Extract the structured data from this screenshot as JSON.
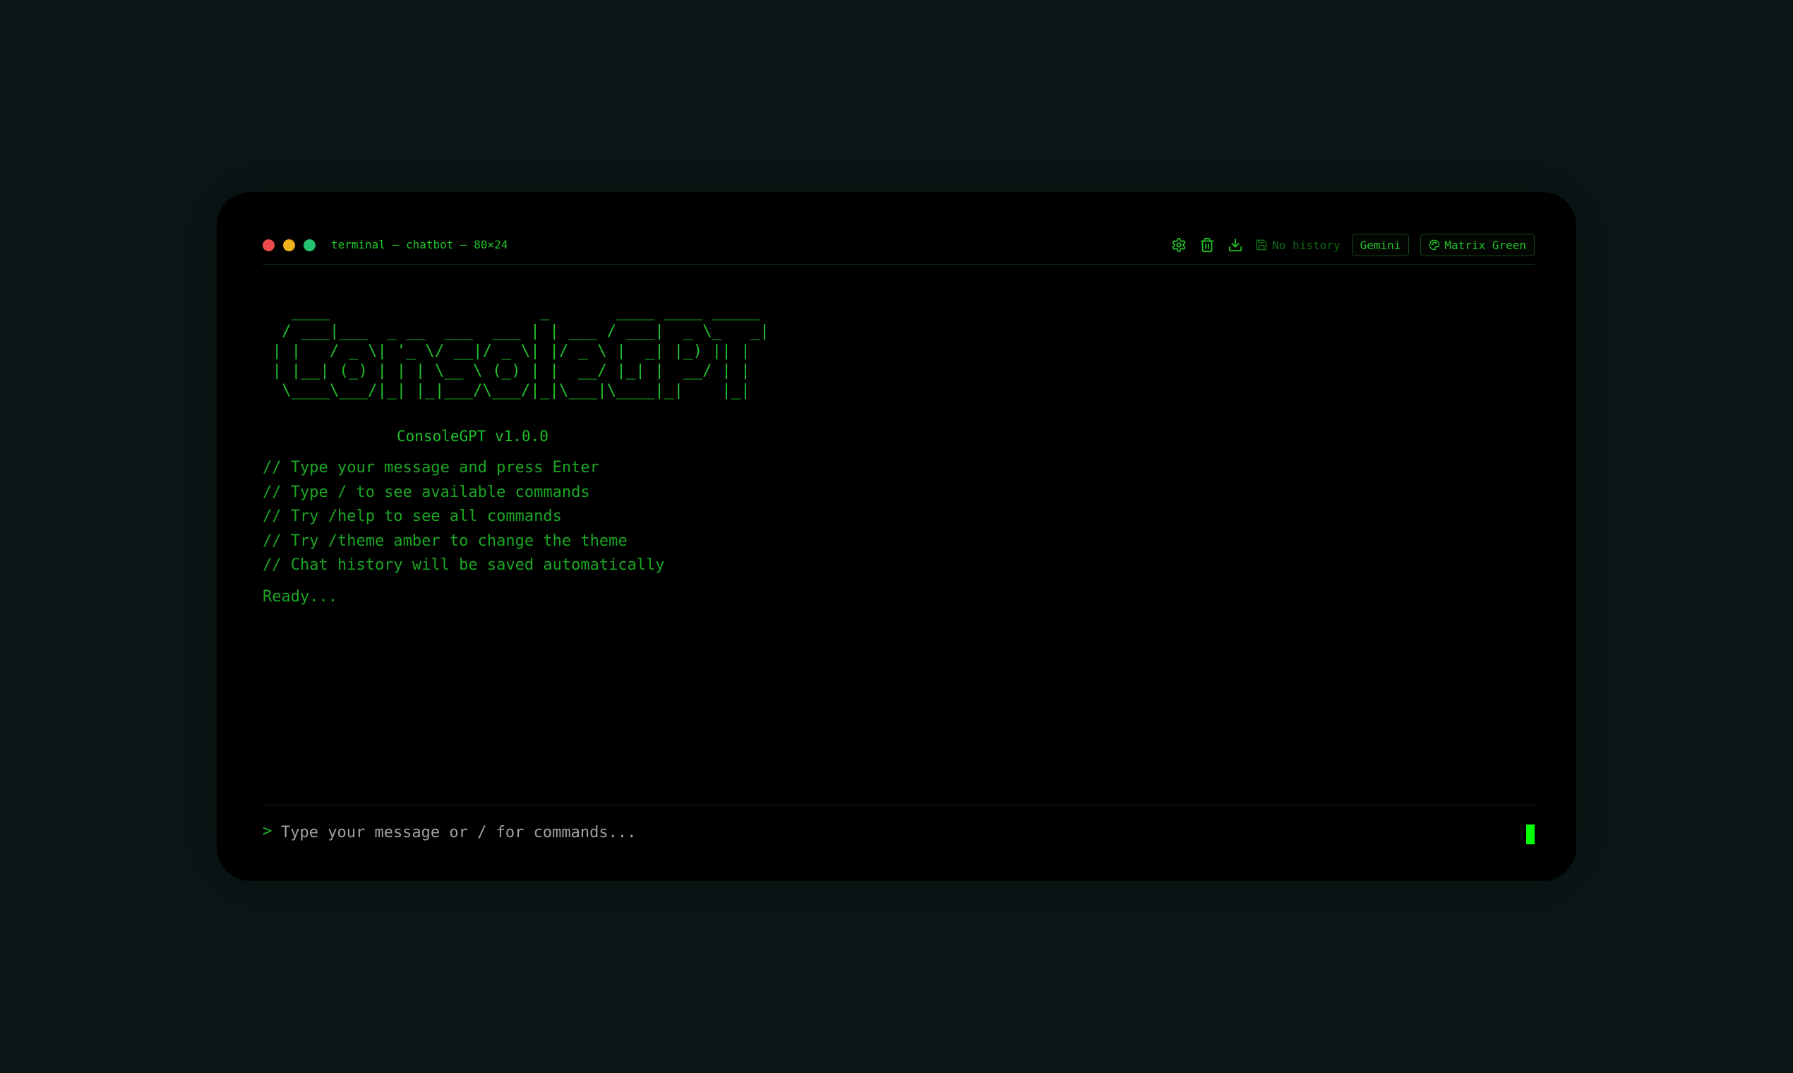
{
  "window": {
    "title": "terminal — chatbot — 80×24"
  },
  "toolbar": {
    "settings_icon": "gear-icon",
    "clear_icon": "trash-icon",
    "download_icon": "download-icon",
    "history_label": "No history",
    "model_label": "Gemini",
    "theme_label": "Matrix Green"
  },
  "banner": {
    "ascii_art": "   ____                      _       ____ ____ _____\n  / ___|___  _ __  ___  ___ | | ___ / ___|  _ \\_   _|\n | |   / _ \\| '_ \\/ __|/ _ \\| |/ _ \\ |  _| |_) || |\n | |__| (_) | | | \\__ \\ (_) | |  __/ |_| |  __/ | |\n  \\____\\___/|_| |_|___/\\___/|_|\\___|\\____|_|    |_|",
    "version": "ConsoleGPT v1.0.0"
  },
  "hints": [
    "// Type your message and press Enter",
    "// Type / to see available commands",
    "// Try /help to see all commands",
    "// Try /theme amber to change the theme",
    "// Chat history will be saved automatically"
  ],
  "status": {
    "ready": "Ready..."
  },
  "input": {
    "prompt": ">",
    "placeholder": "Type your message or / for commands...",
    "value": ""
  },
  "colors": {
    "background": "#0a1716",
    "terminal": "#000000",
    "accent": "#22c32a",
    "cursor": "#00ff00",
    "dot_red": "#ee4b4b",
    "dot_yellow": "#f0b21c",
    "dot_green": "#22c26e"
  }
}
